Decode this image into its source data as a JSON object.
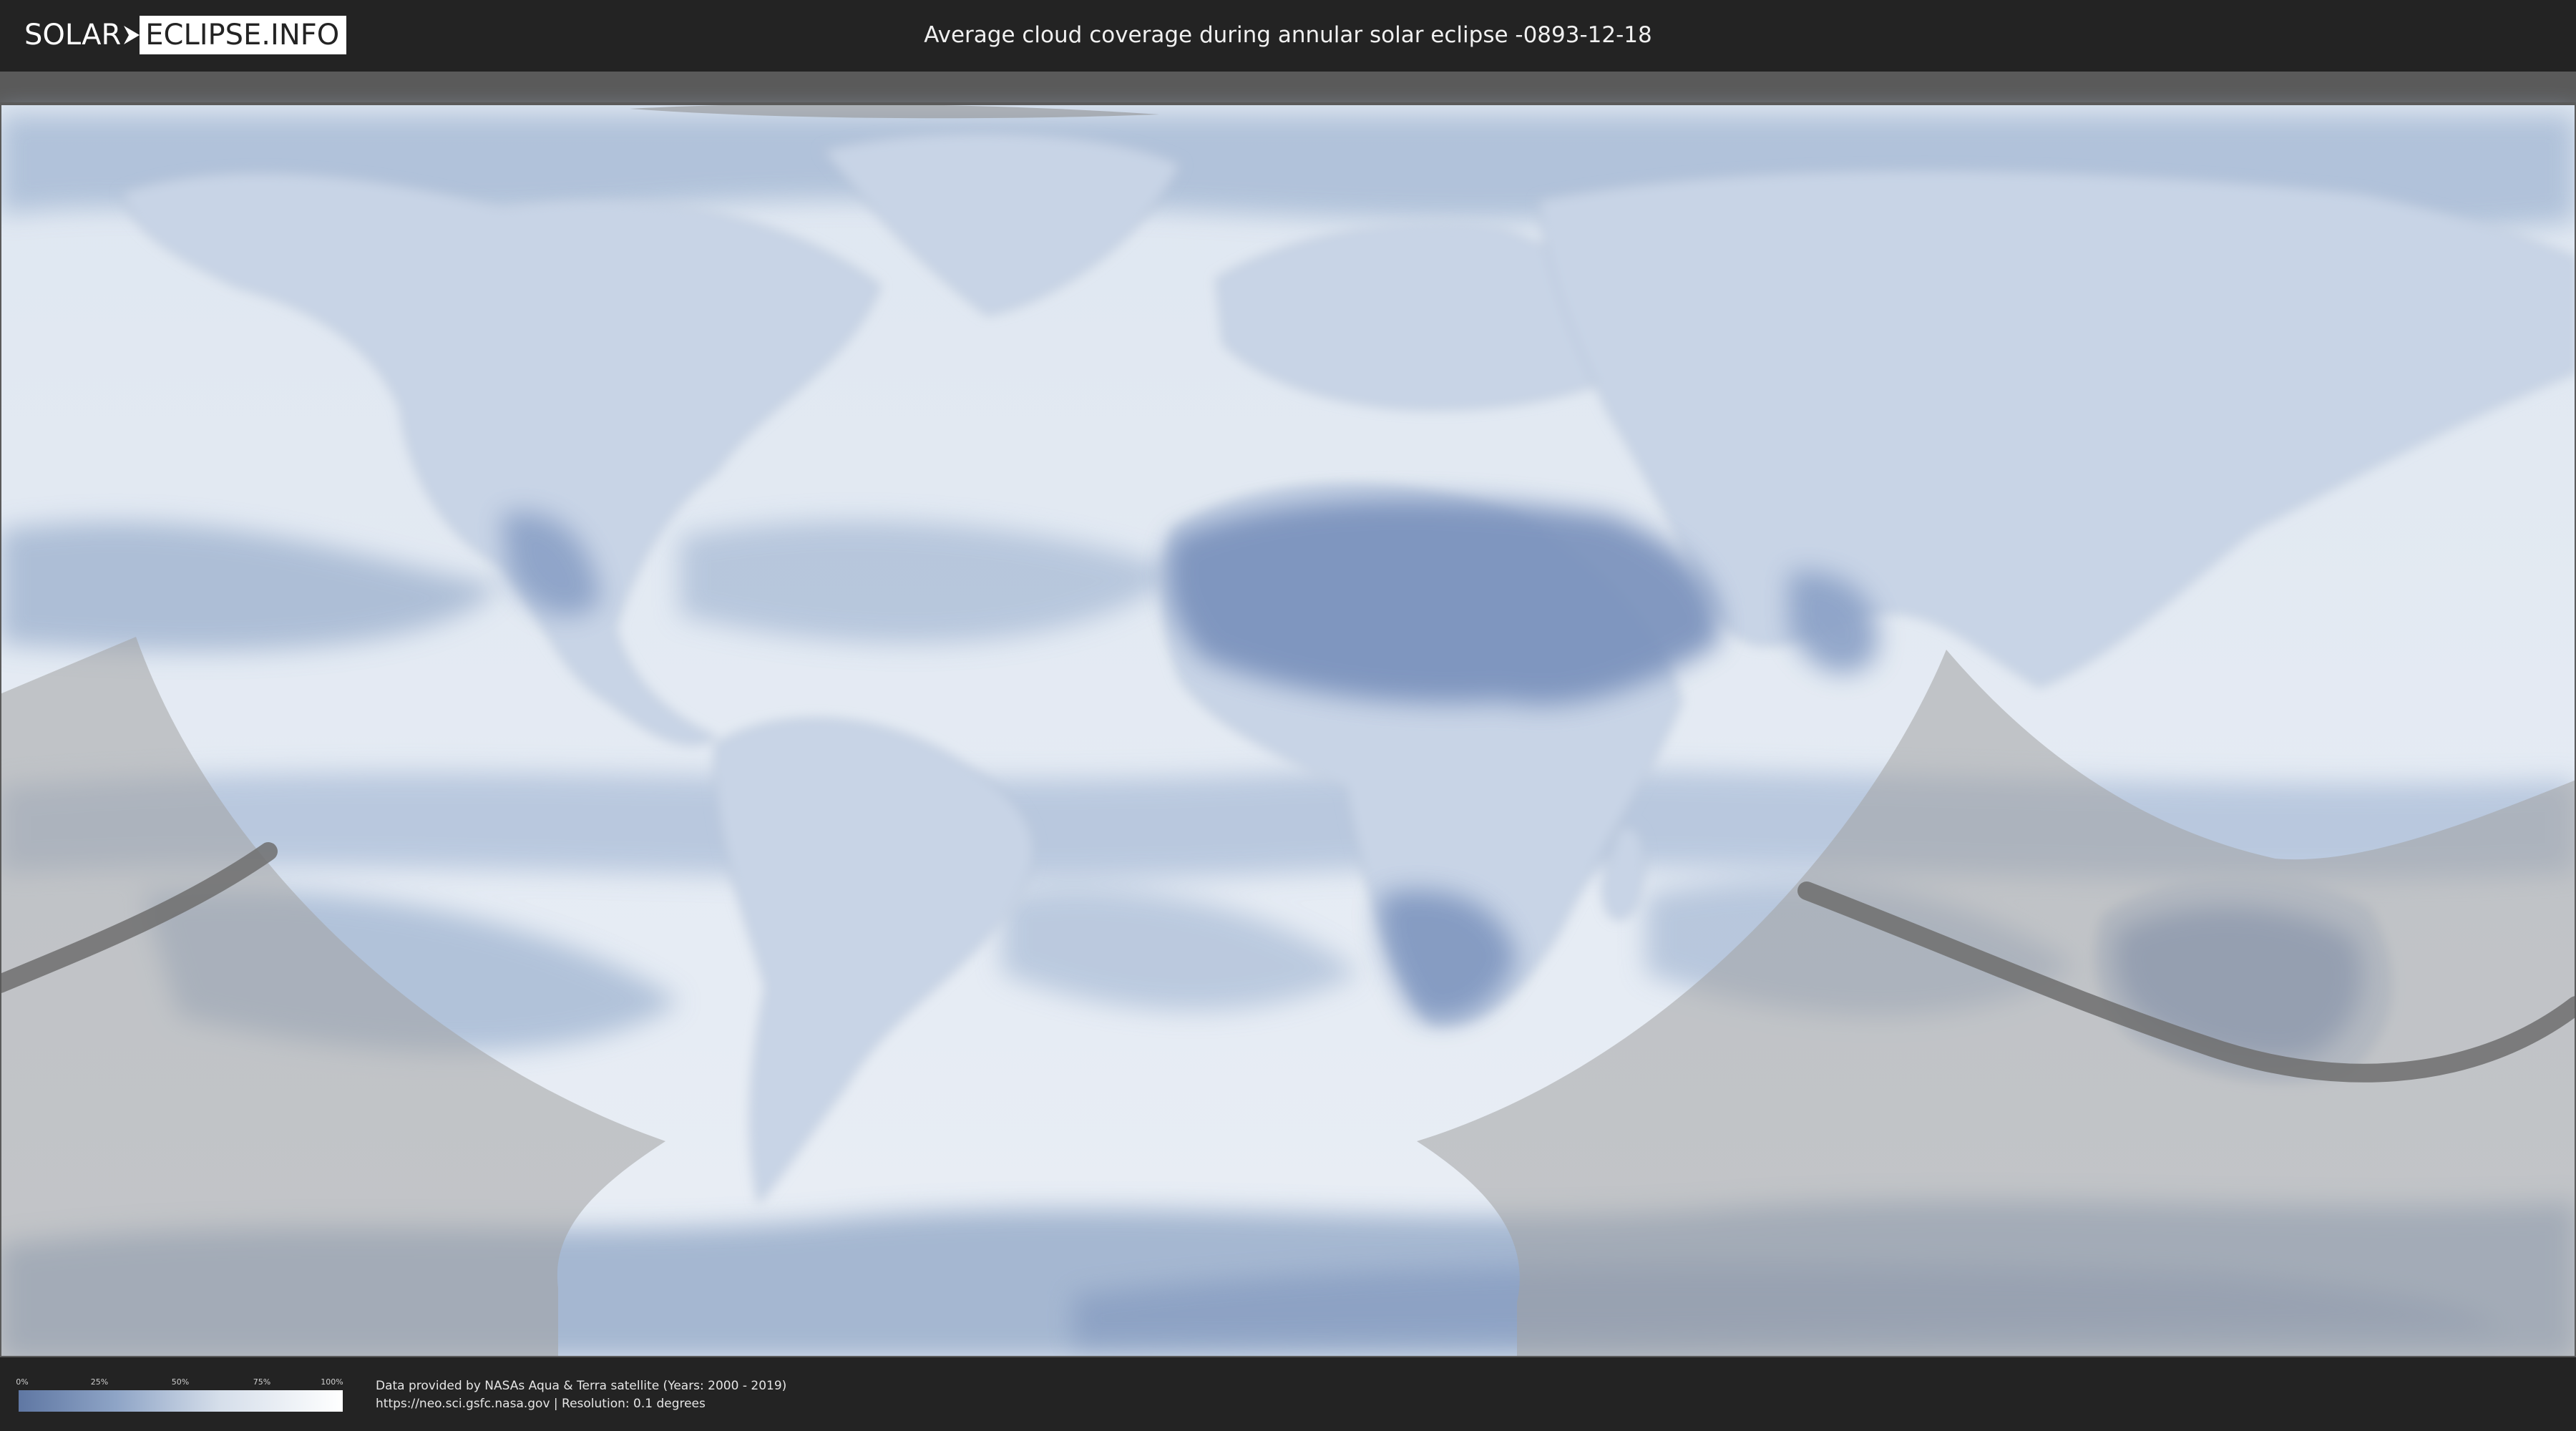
{
  "header": {
    "logo_left": "SOLAR",
    "logo_right": "ECLIPSE.INFO",
    "title": "Average cloud coverage during annular solar eclipse -0893-12-18"
  },
  "legend": {
    "ticks": [
      "0%",
      "25%",
      "50%",
      "75%",
      "100%"
    ],
    "colors": {
      "low": "#5f77a3",
      "high": "#ffffff"
    }
  },
  "footer": {
    "credit_line1": "Data provided by NASAs Aqua & Terra satellite (Years: 2000 - 2019)",
    "credit_line2": "https://neo.sci.gsfc.nasa.gov | Resolution: 0.1 degrees"
  },
  "map": {
    "projection": "equirectangular",
    "ocean_color": "#dfe7f1",
    "cloud_low_color": "#6f88b4",
    "night_shade_color": "#8f8f8f",
    "eclipse_path_color": "#6e6e6e"
  }
}
